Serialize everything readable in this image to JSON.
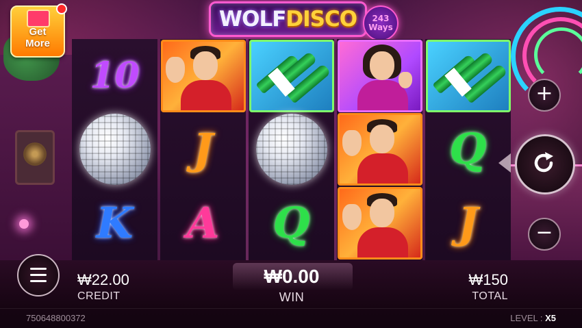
{
  "logo": {
    "title_part1": "WOLF",
    "title_part2": "DISCO",
    "ways_number": "243",
    "ways_label": "Ways"
  },
  "get_more": {
    "label_line1": "Get",
    "label_line2": "More"
  },
  "reels": [
    [
      "10",
      "disco-ball",
      "K"
    ],
    [
      "man-portrait",
      "J",
      "A"
    ],
    [
      "bottles",
      "disco-ball",
      "Q"
    ],
    [
      "woman-portrait",
      "man-portrait",
      "man-portrait"
    ],
    [
      "bottles",
      "Q",
      "J"
    ]
  ],
  "controls": {
    "plus": "+",
    "minus": "−"
  },
  "stats": {
    "credit_value": "₩22.00",
    "credit_label": "CREDIT",
    "win_value": "₩0.00",
    "win_label": "WIN",
    "total_value": "₩150",
    "total_label": "TOTAL"
  },
  "footer": {
    "session_id": "750648800372",
    "level_label": "LEVEL :",
    "level_value": "X5"
  },
  "colors": {
    "accent": "#ff5ad0",
    "gold": "#ffd13a"
  }
}
